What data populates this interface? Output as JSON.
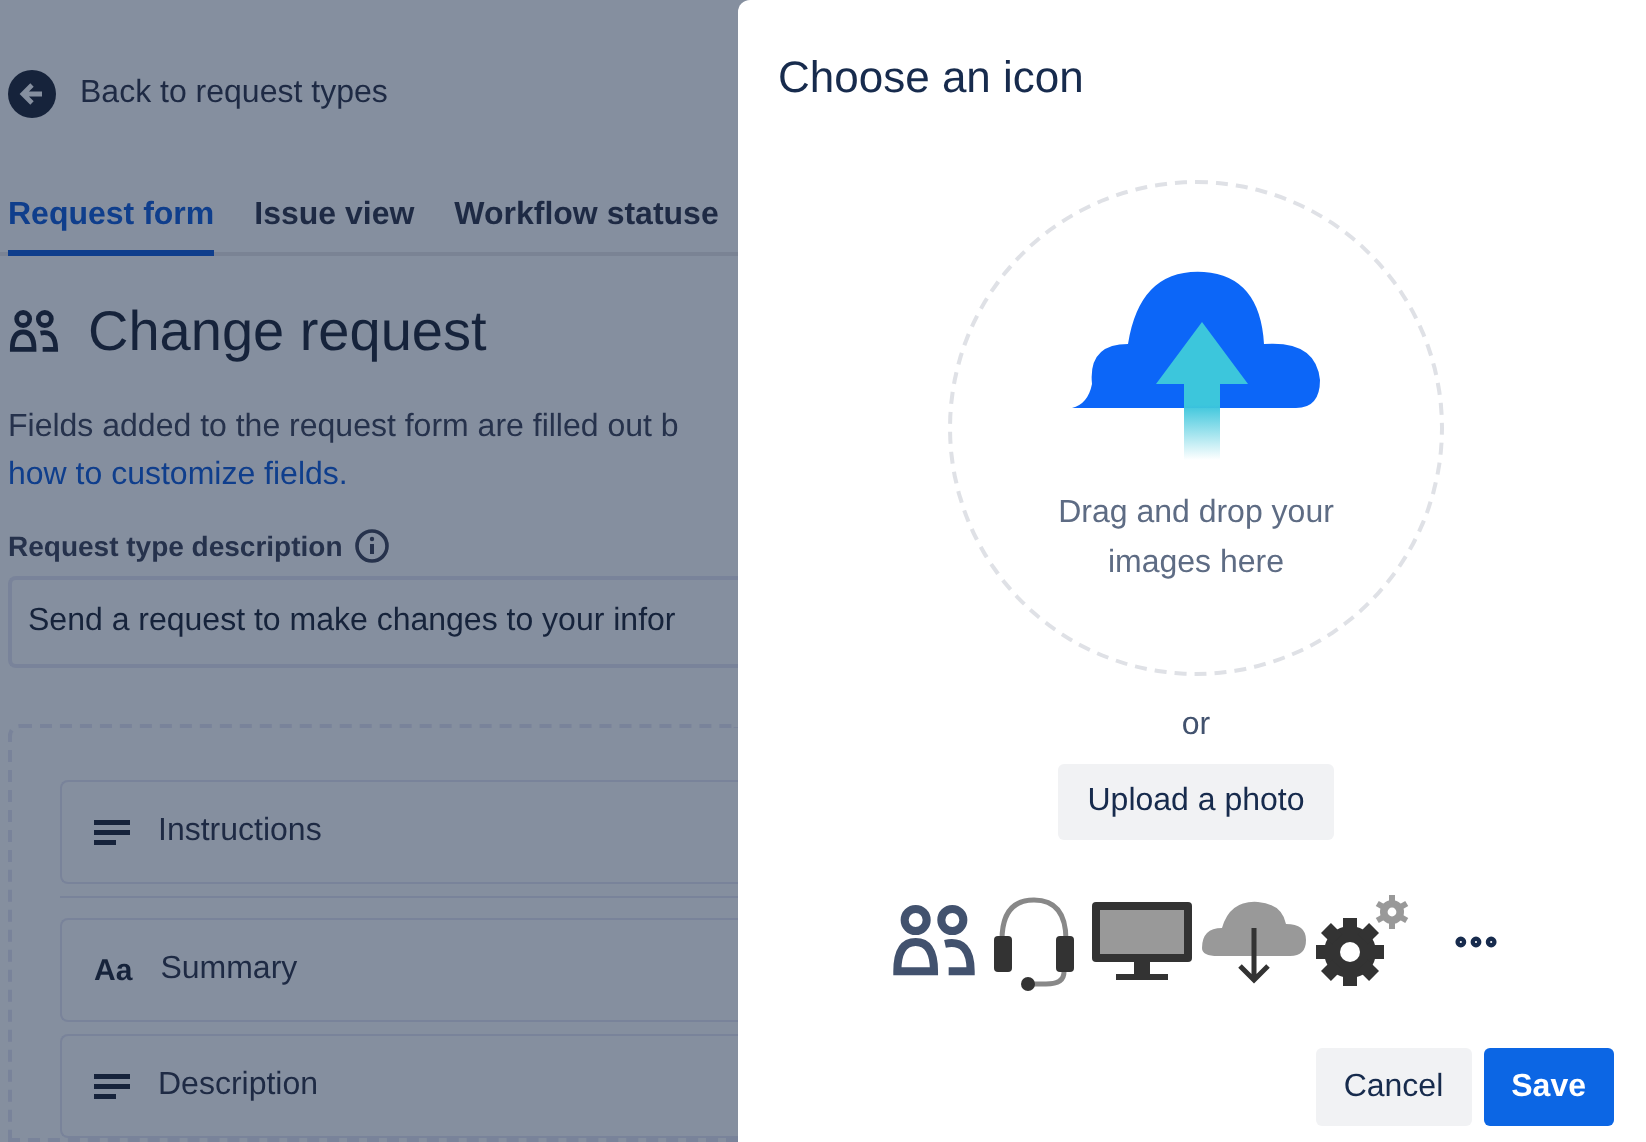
{
  "page": {
    "back_link": "Back to request types",
    "tabs": [
      {
        "label": "Request form",
        "selected": true
      },
      {
        "label": "Issue view",
        "selected": false
      },
      {
        "label": "Workflow statuse",
        "selected": false
      }
    ],
    "heading": "Change request",
    "intro": "Fields added to the request form are filled out b",
    "intro_link": "how to customize fields.",
    "description_label": "Request type description",
    "description_value": "Send a request to make changes to your infor",
    "fields": [
      {
        "kind": "paragraph",
        "label": "Instructions"
      },
      {
        "kind": "text",
        "glyph": "Aa",
        "label": "Summary"
      },
      {
        "kind": "paragraph",
        "label": "Description"
      }
    ]
  },
  "dialog": {
    "title": "Choose an icon",
    "drop_text": "Drag and drop your images here",
    "or": "or",
    "upload_button": "Upload a photo",
    "buttons": [
      {
        "label": "Cancel",
        "kind": "secondary"
      },
      {
        "label": "Save",
        "kind": "primary"
      }
    ]
  }
}
